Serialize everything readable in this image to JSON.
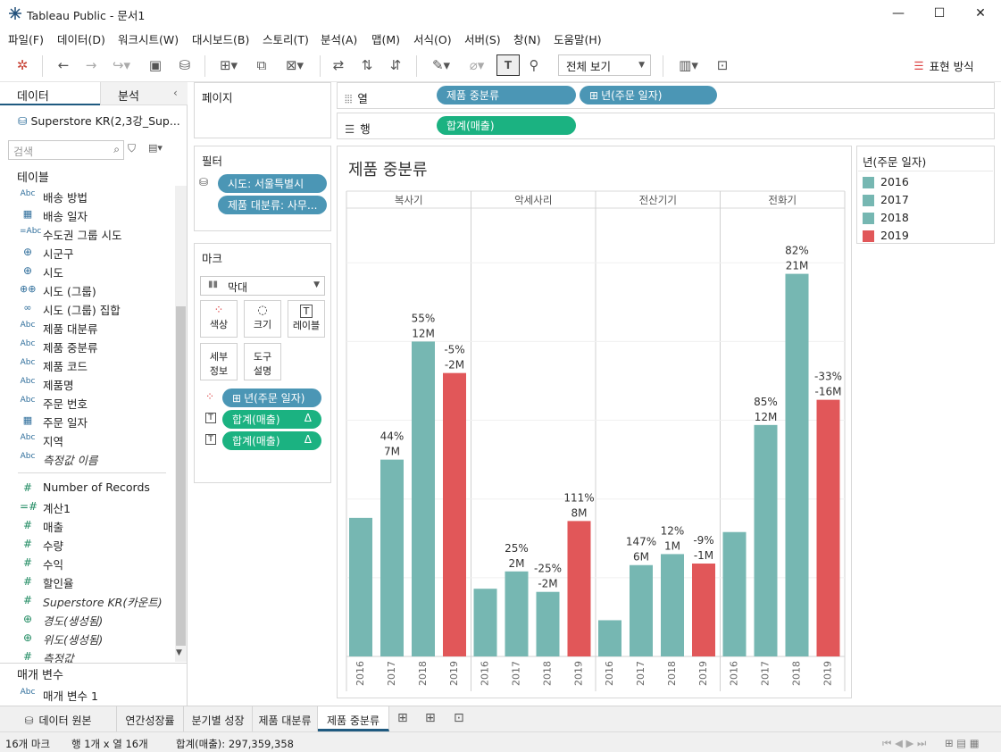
{
  "window": {
    "title": "Tableau Public - 문서1",
    "min": "—",
    "max": "☐",
    "close": "✕"
  },
  "menu": [
    "파일(F)",
    "데이터(D)",
    "워크시트(W)",
    "대시보드(B)",
    "스토리(T)",
    "분석(A)",
    "맵(M)",
    "서식(O)",
    "서버(S)",
    "창(N)",
    "도움말(H)"
  ],
  "toolbar": {
    "view_select": "전체 보기",
    "show_me": "표현 방식"
  },
  "left_pane": {
    "tab_data": "데이터",
    "tab_analysis": "분석",
    "datasource": "Superstore KR(2,3강_Sup...",
    "search_placeholder": "검색",
    "tables_header": "테이블",
    "dimensions": [
      {
        "icon": "Abc",
        "name": "배송 방법"
      },
      {
        "icon": "cal",
        "name": "배송 일자"
      },
      {
        "icon": "=Abc",
        "name": "수도권 그룹 시도"
      },
      {
        "icon": "globe",
        "name": "시군구"
      },
      {
        "icon": "globe",
        "name": "시도"
      },
      {
        "icon": "clip",
        "name": "시도 (그룹)"
      },
      {
        "icon": "set",
        "name": "시도 (그룹) 집합"
      },
      {
        "icon": "Abc",
        "name": "제품 대분류"
      },
      {
        "icon": "Abc",
        "name": "제품 중분류"
      },
      {
        "icon": "Abc",
        "name": "제품 코드"
      },
      {
        "icon": "Abc",
        "name": "제품명"
      },
      {
        "icon": "Abc",
        "name": "주문 번호"
      },
      {
        "icon": "cal",
        "name": "주문 일자"
      },
      {
        "icon": "Abc",
        "name": "지역"
      },
      {
        "icon": "Abc",
        "name": "측정값 이름",
        "italic": true
      }
    ],
    "measures": [
      {
        "icon": "#",
        "name": "Number of Records"
      },
      {
        "icon": "=#",
        "name": "계산1"
      },
      {
        "icon": "#",
        "name": "매출"
      },
      {
        "icon": "#",
        "name": "수량"
      },
      {
        "icon": "#",
        "name": "수익"
      },
      {
        "icon": "#",
        "name": "할인율"
      },
      {
        "icon": "#",
        "name": "Superstore KR(카운트)",
        "italic": true
      },
      {
        "icon": "globe",
        "name": "경도(생성됨)",
        "italic": true
      },
      {
        "icon": "globe",
        "name": "위도(생성됨)",
        "italic": true
      },
      {
        "icon": "#",
        "name": "측정값",
        "italic": true
      }
    ],
    "params_header": "매개 변수",
    "params": [
      {
        "icon": "Abc",
        "name": "매개 변수 1"
      }
    ]
  },
  "shelves": {
    "pages": "페이지",
    "filters": "필터",
    "filter_pills": [
      "시도: 서울특별시",
      "제품 대분류: 사무..."
    ],
    "marks": "마크",
    "mark_type": "막대",
    "mark_buttons": {
      "color": "색상",
      "size": "크기",
      "label": "레이블",
      "detail": "세부\n정보",
      "tooltip": "도구\n설명"
    },
    "mark_pills": [
      "년(주문 일자)",
      "합계(매출)",
      "합계(매출)"
    ],
    "delta": "Δ",
    "columns_label": "열",
    "rows_label": "행",
    "column_pills": [
      "제품 중분류",
      "년(주문 일자)"
    ],
    "row_pills": [
      "합계(매출)"
    ]
  },
  "legend": {
    "title": "년(주문 일자)",
    "items": [
      {
        "label": "2016",
        "color": "#76b7b2"
      },
      {
        "label": "2017",
        "color": "#76b7b2"
      },
      {
        "label": "2018",
        "color": "#76b7b2"
      },
      {
        "label": "2019",
        "color": "#e15759"
      }
    ]
  },
  "chart_data": {
    "type": "bar",
    "title": "제품 중분류",
    "panes": [
      "복사기",
      "악세사리",
      "전산기기",
      "전화기"
    ],
    "x_labels": [
      "2016",
      "2017",
      "2018",
      "2019"
    ],
    "colors": {
      "base": "#76b7b2",
      "highlight": "#e15759"
    },
    "highlight_year": "2019",
    "series": [
      {
        "pane": "복사기",
        "values": [
          8.8,
          12.5,
          20.0,
          18.0
        ],
        "labels": [
          [
            "",
            ""
          ],
          [
            "44%",
            "7M"
          ],
          [
            "55%",
            "12M"
          ],
          [
            "-5%",
            "-2M"
          ]
        ]
      },
      {
        "pane": "악세사리",
        "values": [
          4.3,
          5.4,
          4.1,
          8.6
        ],
        "labels": [
          [
            "",
            ""
          ],
          [
            "25%",
            "2M"
          ],
          [
            "-25%",
            "-2M"
          ],
          [
            "111%",
            "8M"
          ]
        ]
      },
      {
        "pane": "전산기기",
        "values": [
          2.3,
          5.8,
          6.5,
          5.9
        ],
        "labels": [
          [
            "",
            ""
          ],
          [
            "147%",
            "6M"
          ],
          [
            "12%",
            "1M"
          ],
          [
            "-9%",
            "-1M"
          ]
        ]
      },
      {
        "pane": "전화기",
        "values": [
          7.9,
          14.7,
          24.3,
          16.3
        ],
        "labels": [
          [
            "",
            ""
          ],
          [
            "85%",
            "12M"
          ],
          [
            "82%",
            "21M"
          ],
          [
            "-33%",
            "-16M"
          ]
        ]
      }
    ],
    "ylim": [
      0,
      27
    ]
  },
  "sheet_tabs": [
    "데이터 원본",
    "연간성장률",
    "분기별 성장",
    "제품 대분류",
    "제품 중분류"
  ],
  "active_tab": "제품 중분류",
  "status": {
    "marks": "16개 마크",
    "rowscols": "행 1개 x 열 16개",
    "sum": "합계(매출): 297,359,358"
  }
}
